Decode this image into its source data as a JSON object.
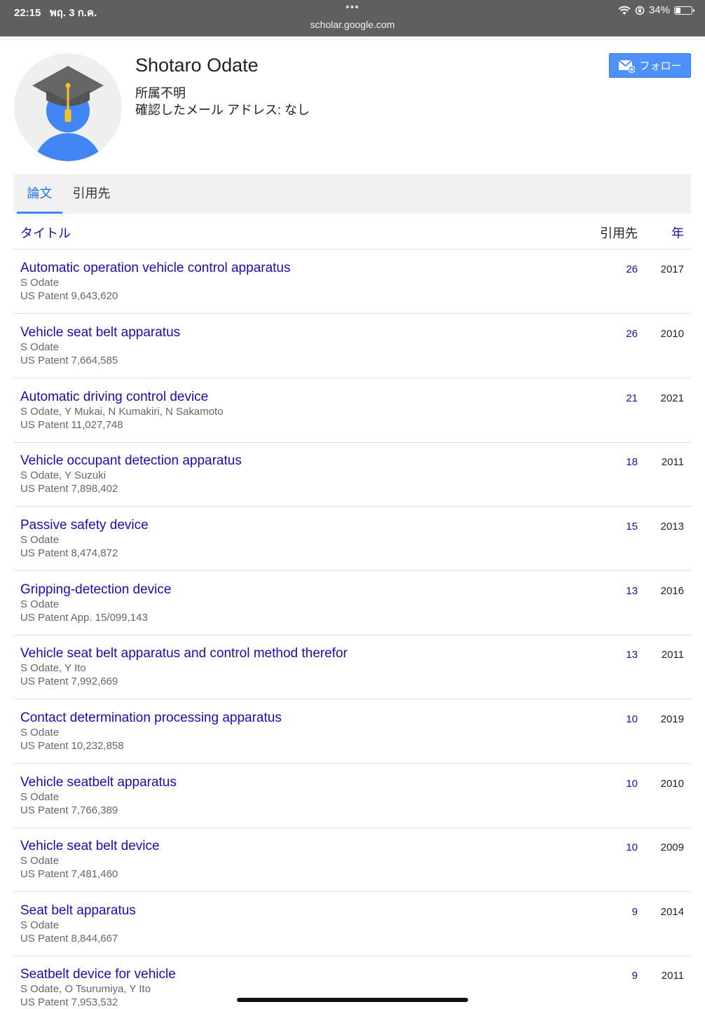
{
  "status_bar": {
    "time": "22:15",
    "date": "พฤ. 3 ก.ค.",
    "dots": "•••",
    "url": "scholar.google.com",
    "battery": "34%",
    "battery_level": 0.34
  },
  "profile": {
    "name": "Shotaro Odate",
    "affiliation": "所属不明",
    "email": "確認したメール アドレス: なし",
    "follow_label": "フォロー"
  },
  "tabs": [
    {
      "label": "論文",
      "active": true
    },
    {
      "label": "引用先",
      "active": false
    }
  ],
  "columns": {
    "title": "タイトル",
    "cited_by": "引用先",
    "year": "年"
  },
  "articles": [
    {
      "title": "Automatic operation vehicle control apparatus",
      "authors": "S Odate",
      "venue": "US Patent 9,643,620",
      "cited": "26",
      "year": "2017"
    },
    {
      "title": "Vehicle seat belt apparatus",
      "authors": "S Odate",
      "venue": "US Patent 7,664,585",
      "cited": "26",
      "year": "2010"
    },
    {
      "title": "Automatic driving control device",
      "authors": "S Odate, Y Mukai, N Kumakiri, N Sakamoto",
      "venue": "US Patent 11,027,748",
      "cited": "21",
      "year": "2021"
    },
    {
      "title": "Vehicle occupant detection apparatus",
      "authors": "S Odate, Y Suzuki",
      "venue": "US Patent 7,898,402",
      "cited": "18",
      "year": "2011"
    },
    {
      "title": "Passive safety device",
      "authors": "S Odate",
      "venue": "US Patent 8,474,872",
      "cited": "15",
      "year": "2013"
    },
    {
      "title": "Gripping-detection device",
      "authors": "S Odate",
      "venue": "US Patent App. 15/099,143",
      "cited": "13",
      "year": "2016"
    },
    {
      "title": "Vehicle seat belt apparatus and control method therefor",
      "authors": "S Odate, Y Ito",
      "venue": "US Patent 7,992,669",
      "cited": "13",
      "year": "2011"
    },
    {
      "title": "Contact determination processing apparatus",
      "authors": "S Odate",
      "venue": "US Patent 10,232,858",
      "cited": "10",
      "year": "2019"
    },
    {
      "title": "Vehicle seatbelt apparatus",
      "authors": "S Odate",
      "venue": "US Patent 7,766,389",
      "cited": "10",
      "year": "2010"
    },
    {
      "title": "Vehicle seat belt device",
      "authors": "S Odate",
      "venue": "US Patent 7,481,460",
      "cited": "10",
      "year": "2009"
    },
    {
      "title": "Seat belt apparatus",
      "authors": "S Odate",
      "venue": "US Patent 8,844,667",
      "cited": "9",
      "year": "2014"
    },
    {
      "title": "Seatbelt device for vehicle",
      "authors": "S Odate, O Tsurumiya, Y Ito",
      "venue": "US Patent 7,953,532",
      "cited": "9",
      "year": "2011"
    }
  ]
}
